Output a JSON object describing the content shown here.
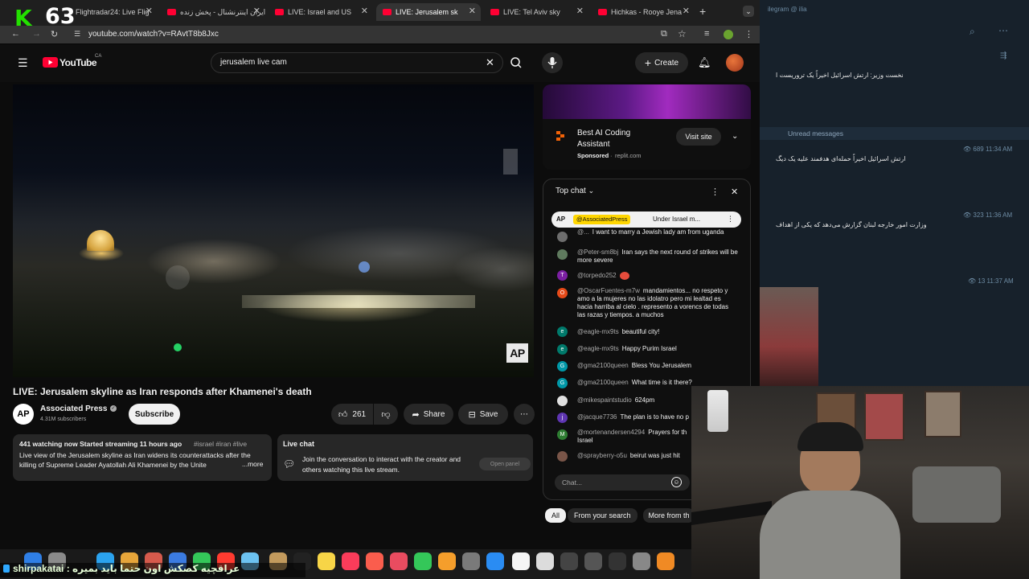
{
  "overlay": {
    "logo_letter": "K",
    "viewer_count": "63"
  },
  "browser": {
    "tabs": [
      {
        "label": "Flightradar24: Live Flig"
      },
      {
        "label": "ایران اینترنشنال - پخش زنده"
      },
      {
        "label": "LIVE: Israel and US"
      },
      {
        "label": "LIVE: Jerusalem sk"
      },
      {
        "label": "LIVE: Tel Aviv sky"
      },
      {
        "label": "Hichkas - Rooye Jena"
      }
    ],
    "url": "youtube.com/watch?v=RAvtT8b8Jxc"
  },
  "youtube": {
    "logo": "YouTube",
    "region": "CA",
    "search_query": "jerusalem live cam",
    "create_label": "Create"
  },
  "video": {
    "title": "LIVE: Jerusalem skyline as Iran responds after Khamenei's death",
    "watermark": "AP",
    "channel": {
      "avatar": "AP",
      "name": "Associated Press",
      "subscribers": "4.31M subscribers"
    },
    "subscribe_label": "Subscribe",
    "likes": "261",
    "share_label": "Share",
    "save_label": "Save",
    "description": {
      "stats": "441 watching now  Started streaming 11 hours ago",
      "tags": "#israel #iran #live",
      "text": "Live view of the Jerusalem skyline as Iran widens its counterattacks after the killing of Supreme Leader Ayatollah Ali Khamenei by the Unite",
      "more": "...more"
    },
    "live_chat_box": {
      "title": "Live chat",
      "text": "Join the conversation to interact with the creator and others watching this live stream.",
      "button": "Open panel"
    }
  },
  "ad": {
    "title": "Best AI Coding Assistant",
    "sponsored": "Sponsored",
    "domain": "replit.com",
    "button": "Visit site"
  },
  "chat": {
    "header": "Top chat",
    "pinned": {
      "avatar": "AP",
      "user": "@AssociatedPress",
      "text": "Under Israel m..."
    },
    "messages": [
      {
        "avatar": "",
        "user": "@...",
        "text": "I want to marry a Jewish lady am from uganda"
      },
      {
        "avatar": "",
        "user": "@Peter-sm8bj",
        "text": "Iran says the next round of strikes will be more severe"
      },
      {
        "avatar": "T",
        "user": "@torpedo252",
        "text": ""
      },
      {
        "avatar": "O",
        "user": "@OscarFuentes-m7w",
        "text": "mandamientos... no respeto y amo a la mujeres no las idolatro pero mi lealtad es hacia harriba al cielo . represento a vorencs de todas las razas y tiempos. a muchos"
      },
      {
        "avatar": "e",
        "user": "@eagle-mx9ts",
        "text": "beautiful city!"
      },
      {
        "avatar": "e",
        "user": "@eagle-mx9ts",
        "text": "Happy Purim Israel"
      },
      {
        "avatar": "G",
        "user": "@gma2100queen",
        "text": "Bless You Jerusalem"
      },
      {
        "avatar": "G",
        "user": "@gma2100queen",
        "text": "What time is it there?"
      },
      {
        "avatar": "",
        "user": "@mikespaintstudio",
        "text": "624pm"
      },
      {
        "avatar": "j",
        "user": "@jacque7736",
        "text": "The plan is to have no p"
      },
      {
        "avatar": "M",
        "user": "@mortenandersen4294",
        "text": "Prayers for th Israel"
      },
      {
        "avatar": "",
        "user": "@sprayberry-o5u",
        "text": "beirut was just hit"
      }
    ],
    "input_placeholder": "Chat...",
    "filters": [
      "All",
      "From your search",
      "More from th"
    ]
  },
  "telegram": {
    "header": "ilegram @ ilia",
    "unread": "Unread messages",
    "messages": [
      {
        "text": "نخست وزیر: ارتش اسرائیل اخیراً یک تروریست ا",
        "meta": ""
      },
      {
        "text": "ارتش اسرائیل اخیراً حمله‌ای هدفمند علیه یک دیگ",
        "meta": "689 11:34 AM"
      },
      {
        "text": "وزارت امور خارجه لبنان گزارش می‌دهد که یکی از اهداف",
        "meta": "323 11:36 AM"
      },
      {
        "text": "",
        "meta": "13 11:37 AM"
      }
    ]
  },
  "bottom_overlay": {
    "text": "shirpakatai : عراقچیه کصکش اون حتما باید بمیره"
  },
  "colors": {
    "yt_red": "#ff0033",
    "chat_bg": "#0f0f0f",
    "telegram_bg": "#17212b",
    "overlay_green": "#23e000"
  }
}
